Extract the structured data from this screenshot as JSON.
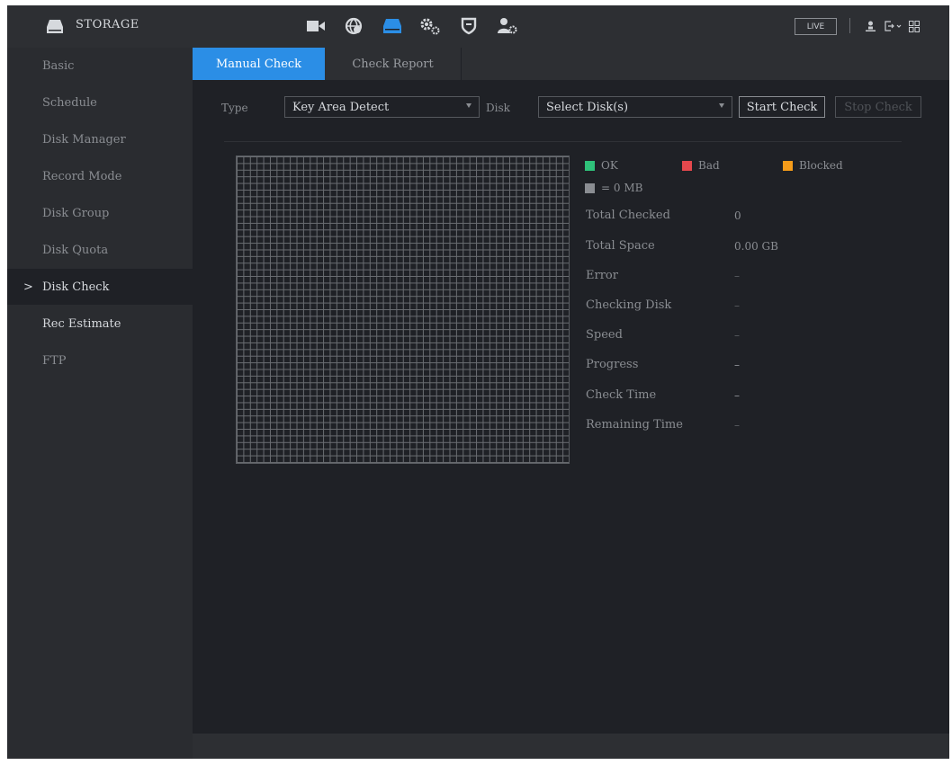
{
  "app": {
    "title": "STORAGE"
  },
  "header": {
    "nav_icons": [
      "camera-icon",
      "network-icon",
      "storage-icon",
      "settings-icon",
      "security-icon",
      "account-icon"
    ],
    "active_icon": "storage-icon",
    "live_label": "LIVE",
    "right_icons": [
      "user-icon",
      "logout-icon",
      "menu-grid-icon"
    ]
  },
  "sidebar": {
    "items": [
      {
        "label": "Basic"
      },
      {
        "label": "Schedule"
      },
      {
        "label": "Disk Manager"
      },
      {
        "label": "Record Mode"
      },
      {
        "label": "Disk Group"
      },
      {
        "label": "Disk Quota"
      },
      {
        "label": "Disk Check"
      },
      {
        "label": "Rec Estimate"
      },
      {
        "label": "FTP"
      }
    ],
    "active_index": 6,
    "chevron": ">"
  },
  "tabs": [
    {
      "label": "Manual Check"
    },
    {
      "label": "Check Report"
    }
  ],
  "form": {
    "type_label": "Type",
    "type_value": "Key Area Detect",
    "disk_label": "Disk",
    "disk_value": "Select Disk(s)",
    "start_button": "Start Check",
    "stop_button": "Stop Check"
  },
  "legend": {
    "ok": "OK",
    "bad": "Bad",
    "blocked": "Blocked",
    "unit": "= 0 MB"
  },
  "colors": {
    "accent": "#2b8ee6",
    "ok": "#2fc27a",
    "bad": "#e5484d",
    "blocked": "#f59c1a",
    "unit": "#8a8d92"
  },
  "stats": [
    {
      "label": "Total Checked",
      "value": "0"
    },
    {
      "label": "Total Space",
      "value": "0.00 GB"
    },
    {
      "label": "Error",
      "value": "–"
    },
    {
      "label": "Checking Disk",
      "value": "–"
    },
    {
      "label": "Speed",
      "value": "–"
    },
    {
      "label": "Progress",
      "value": "–"
    },
    {
      "label": "Check Time",
      "value": "–"
    },
    {
      "label": "Remaining Time",
      "value": "–"
    }
  ]
}
